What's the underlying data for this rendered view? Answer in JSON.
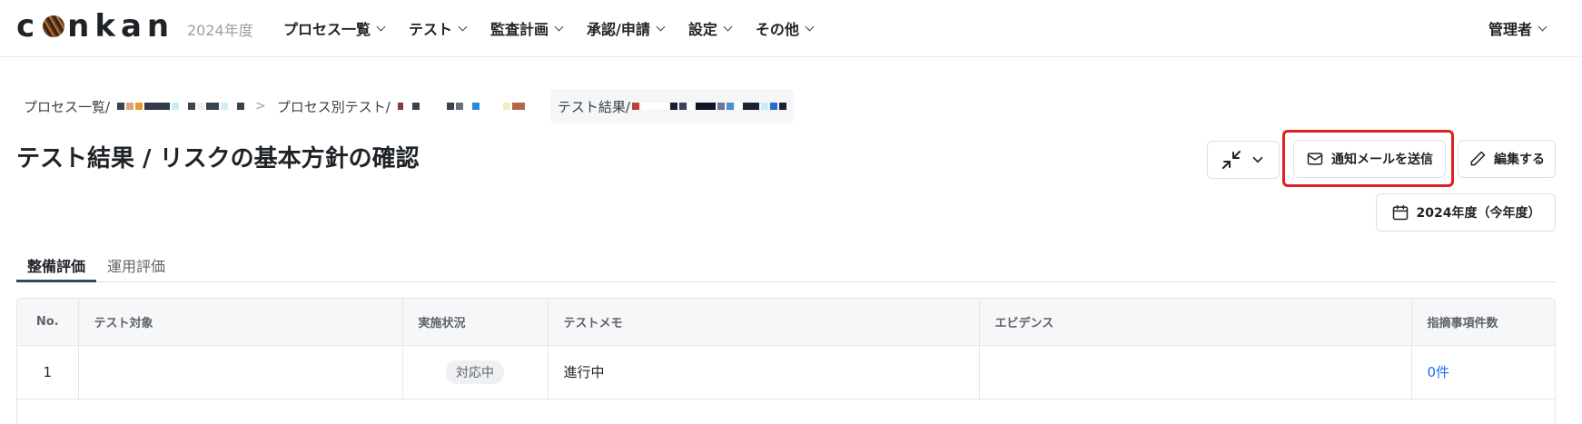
{
  "header": {
    "logo_text_1": "c",
    "logo_text_2": "nkan",
    "fiscal_year": "2024年度",
    "nav": [
      {
        "label": "プロセス一覧"
      },
      {
        "label": "テスト"
      },
      {
        "label": "監査計画"
      },
      {
        "label": "承認/申請"
      },
      {
        "label": "設定"
      },
      {
        "label": "その他"
      }
    ],
    "user_menu": "管理者"
  },
  "breadcrumb": {
    "items": [
      {
        "label": "プロセス一覧/"
      },
      {
        "label": "プロセス別テスト/"
      },
      {
        "label": "テスト結果/"
      }
    ]
  },
  "page": {
    "title": "テスト結果 / リスクの基本方針の確認",
    "buttons": {
      "send_mail": "通知メールを送信",
      "edit": "編集する",
      "year": "2024年度（今年度）"
    }
  },
  "tabs": [
    {
      "label": "整備評価",
      "active": true
    },
    {
      "label": "運用評価",
      "active": false
    }
  ],
  "table": {
    "columns": [
      "No.",
      "テスト対象",
      "実施状況",
      "テストメモ",
      "エビデンス",
      "指摘事項件数"
    ],
    "rows": [
      {
        "no": "1",
        "target": "",
        "status": "対応中",
        "memo": "進行中",
        "evidence": "",
        "findings": "0件"
      }
    ]
  },
  "colors": {
    "highlight": "#e0201c",
    "link": "#1a73e8",
    "tab_active": "#2c4a66"
  }
}
